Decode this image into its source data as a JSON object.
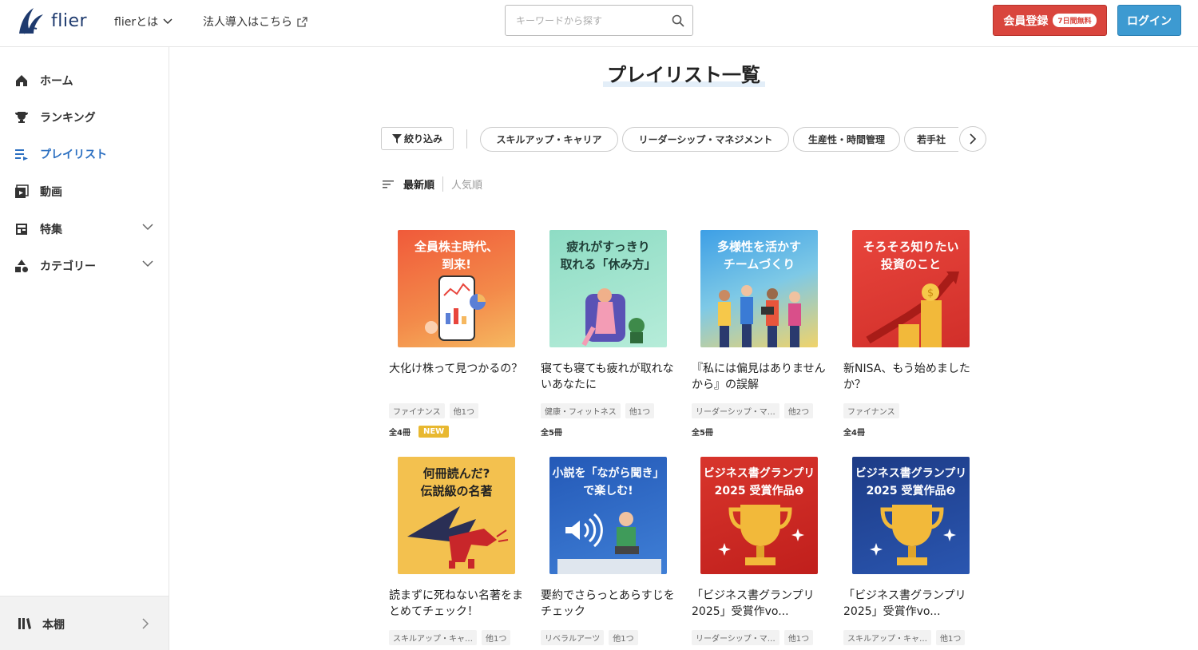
{
  "header": {
    "logo_text": "flier",
    "nav_about": "flierとは",
    "nav_corporate": "法人導入はこちら",
    "search_placeholder": "キーワードから探す",
    "register_label": "会員登録",
    "register_badge": "7日間無料",
    "login_label": "ログイン"
  },
  "sidebar": {
    "items": [
      {
        "label": "ホーム",
        "icon": "home-icon"
      },
      {
        "label": "ランキング",
        "icon": "trophy-icon"
      },
      {
        "label": "プレイリスト",
        "icon": "playlist-icon"
      },
      {
        "label": "動画",
        "icon": "video-icon"
      },
      {
        "label": "特集",
        "icon": "feature-icon"
      },
      {
        "label": "カテゴリー",
        "icon": "category-icon"
      }
    ],
    "bookshelf_label": "本棚"
  },
  "main": {
    "title": "プレイリスト一覧",
    "filter_label": "絞り込み",
    "chips": [
      "スキルアップ・キャリア",
      "リーダーシップ・マネジメント",
      "生産性・時間管理",
      "若手社"
    ],
    "sort_newest": "最新順",
    "sort_popular": "人気順",
    "cards": [
      {
        "thumb_text": "全員株主時代、\n到来!",
        "title": "大化け株って見つかるの？",
        "tag1": "ファイナンス",
        "tag2": "他1つ",
        "count": "全4冊",
        "new": "NEW"
      },
      {
        "thumb_text": "疲れがすっきり\n取れる「休み方」",
        "title": "寝ても寝ても疲れが取れないあなたに",
        "tag1": "健康・フィットネス",
        "tag2": "他1つ",
        "count": "全5冊",
        "new": ""
      },
      {
        "thumb_text": "多様性を活かす\nチームづくり",
        "title": "『私には偏見はありませんから』の誤解",
        "tag1": "リーダーシップ・マ…",
        "tag2": "他2つ",
        "count": "全5冊",
        "new": ""
      },
      {
        "thumb_text": "そろそろ知りたい\n投資のこと",
        "title": "新NISA、もう始めましたか？",
        "tag1": "ファイナンス",
        "tag2": "",
        "count": "全4冊",
        "new": ""
      },
      {
        "thumb_text": "何冊読んだ?\n伝説級の名著",
        "title": "読まずに死ねない名著をまとめてチェック！",
        "tag1": "スキルアップ・キャ…",
        "tag2": "他1つ",
        "count": "",
        "new": ""
      },
      {
        "thumb_text": "小説を「ながら聞き」\nで楽しむ!",
        "title": "要約でさらっとあらすじをチェック",
        "tag1": "リベラルアーツ",
        "tag2": "他1つ",
        "count": "",
        "new": ""
      },
      {
        "thumb_text": "ビジネス書グランプリ\n2025 受賞作品❶",
        "title": "「ビジネス書グランプリ2025」受賞作vo...",
        "tag1": "リーダーシップ・マ…",
        "tag2": "他1つ",
        "count": "",
        "new": ""
      },
      {
        "thumb_text": "ビジネス書グランプリ\n2025 受賞作品❷",
        "title": "「ビジネス書グランプリ2025」受賞作vo...",
        "tag1": "スキルアップ・キャ…",
        "tag2": "他1つ",
        "count": "",
        "new": ""
      }
    ]
  },
  "colors": {
    "accent": "#2b6fc1",
    "register": "#d9453d",
    "login": "#3d9ad1",
    "new_badge": "#e8b830"
  }
}
